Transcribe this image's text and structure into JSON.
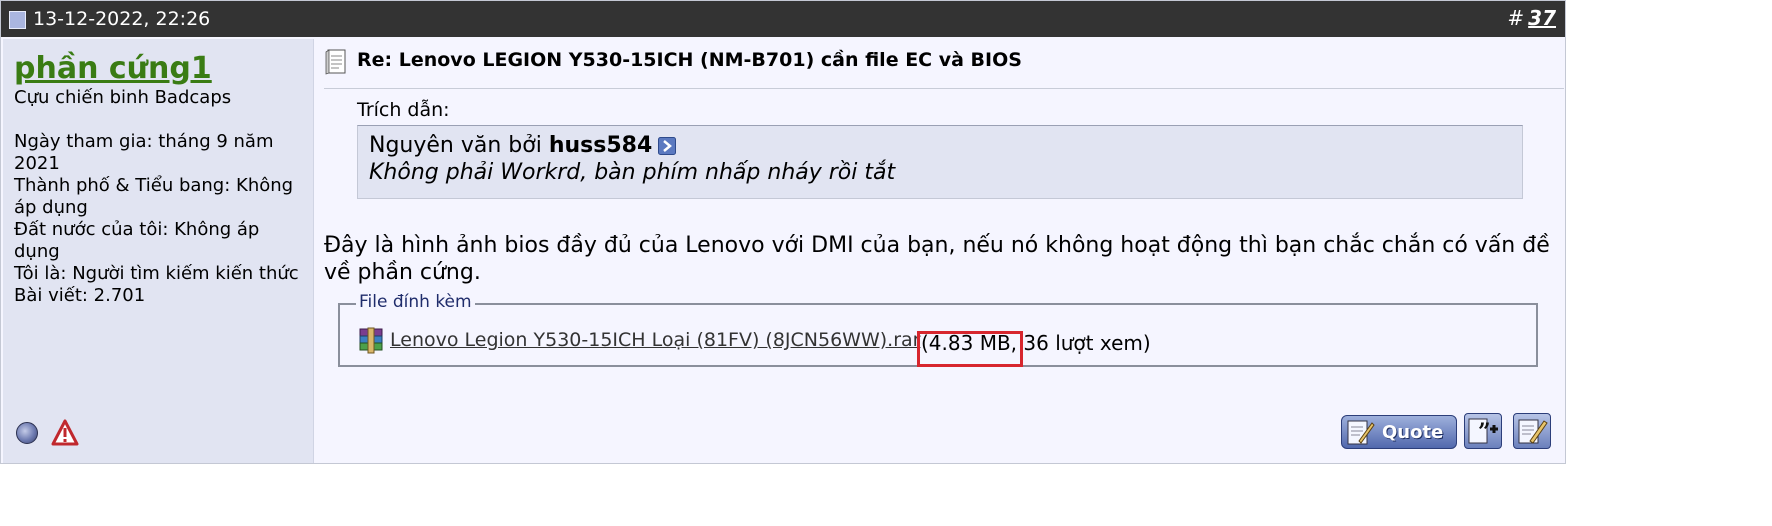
{
  "post": {
    "date": "13-12-2022, 22:26",
    "number_prefix": "#",
    "number": "37"
  },
  "user": {
    "name": "phần cứng1",
    "title": "Cựu chiến binh Badcaps",
    "join_date": "Ngày tham gia: tháng 9 năm 2021",
    "city": "Thành phố & Tiểu bang: Không áp dụng",
    "country": "Đất nước của tôi: Không áp dụng",
    "i_am": "Tôi là: Người tìm kiếm kiến thức",
    "posts": "Bài viết: 2.701"
  },
  "message": {
    "title": "Re: Lenovo LEGION Y530-15ICH (NM-B701) cần file EC và BIOS",
    "quote_label": "Trích dẫn:",
    "quote_author_prefix": "Nguyên văn bởi",
    "quote_author": "huss584",
    "quote_text": "Không phải Workrd, bàn phím nhấp nháy rồi tắt",
    "body": "Đây là hình ảnh bios đầy đủ của Lenovo với DMI của bạn, nếu nó không hoạt động thì bạn chắc chắn có vấn đề về phần cứng."
  },
  "attachments": {
    "legend": "File đính kèm",
    "file_name": "Lenovo Legion Y530-15ICH Loại (81FV) (8JCN56WW).rar",
    "meta": "(4.83 MB, 36 lượt xem)"
  },
  "actions": {
    "quote_label": "Quote"
  },
  "colors": {
    "header_bg": "#333333",
    "username": "#3a7c14",
    "highlight": "#d7262e"
  }
}
